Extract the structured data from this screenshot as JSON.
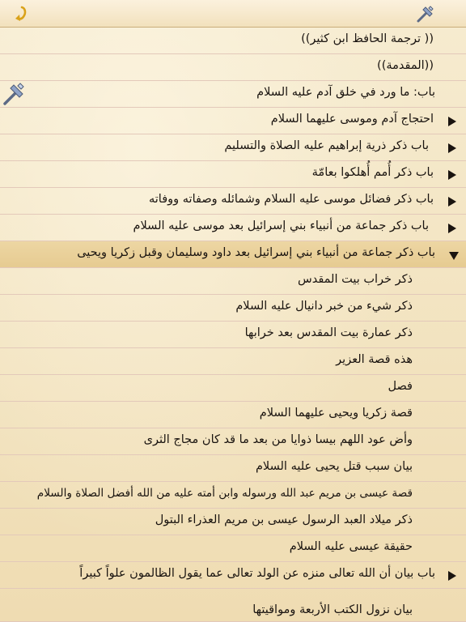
{
  "toolbar": {
    "back_icon": "back-arrow-icon",
    "tools_icon": "tools-icon"
  },
  "items": [
    {
      "label": "(( ترجمة الحافظ ابن كثير))",
      "marker": "none"
    },
    {
      "label": "((المقدمة))",
      "marker": "none"
    },
    {
      "label": "باب: ما ورد في خلق آدم عليه السلام",
      "marker": "none"
    },
    {
      "label": "احتجاج آدم وموسى عليهما السلام",
      "marker": "collapsed"
    },
    {
      "label": "باب ذكر ذرية إبراهيم عليه الصلاة والتسليم",
      "marker": "collapsed"
    },
    {
      "label": "باب ذكر أُمم أُهلكوا بعامّة",
      "marker": "collapsed"
    },
    {
      "label": "باب ذكر فضائل موسى عليه السلام وشمائله وصفاته ووفاته",
      "marker": "collapsed"
    },
    {
      "label": "باب ذكر جماعة من أنبياء بني إسرائيل بعد موسى عليه السلام",
      "marker": "collapsed"
    },
    {
      "label": "باب ذكر جماعة من أنبياء بني إسرائيل بعد داود وسليمان وقبل زكريا ويحيى",
      "marker": "expanded"
    },
    {
      "label": "ذكر خراب بيت المقدس",
      "marker": "child"
    },
    {
      "label": "ذكر شيء من خبر دانيال عليه السلام",
      "marker": "child"
    },
    {
      "label": "ذكر عمارة بيت المقدس بعد خرابها",
      "marker": "child"
    },
    {
      "label": "هذه قصة العزير",
      "marker": "child"
    },
    {
      "label": "فصل",
      "marker": "child"
    },
    {
      "label": "قصة زكريا ويحيى عليهما السلام",
      "marker": "child"
    },
    {
      "label": "وأض عود اللهم بيسا ذوايا من بعد ما قد كان مجاج الثرى",
      "marker": "child"
    },
    {
      "label": "بيان سبب قتل يحيى عليه السلام",
      "marker": "child"
    },
    {
      "label": "قصة عيسى بن مريم عبد الله ورسوله وابن أمته عليه من الله أفضل الصلاة والسلام",
      "marker": "child"
    },
    {
      "label": "ذكر ميلاد العبد الرسول عيسى بن مريم العذراء البتول",
      "marker": "child"
    },
    {
      "label": "حقيقة عيسى عليه السلام",
      "marker": "child"
    },
    {
      "label": "باب بيان أن الله تعالى منزه عن الولد تعالى عما يقول الظالمون علواً كبيراً",
      "marker": "collapsed"
    },
    {
      "label": "بيان نزول الكتب الأربعة ومواقيتها",
      "marker": "child"
    }
  ]
}
